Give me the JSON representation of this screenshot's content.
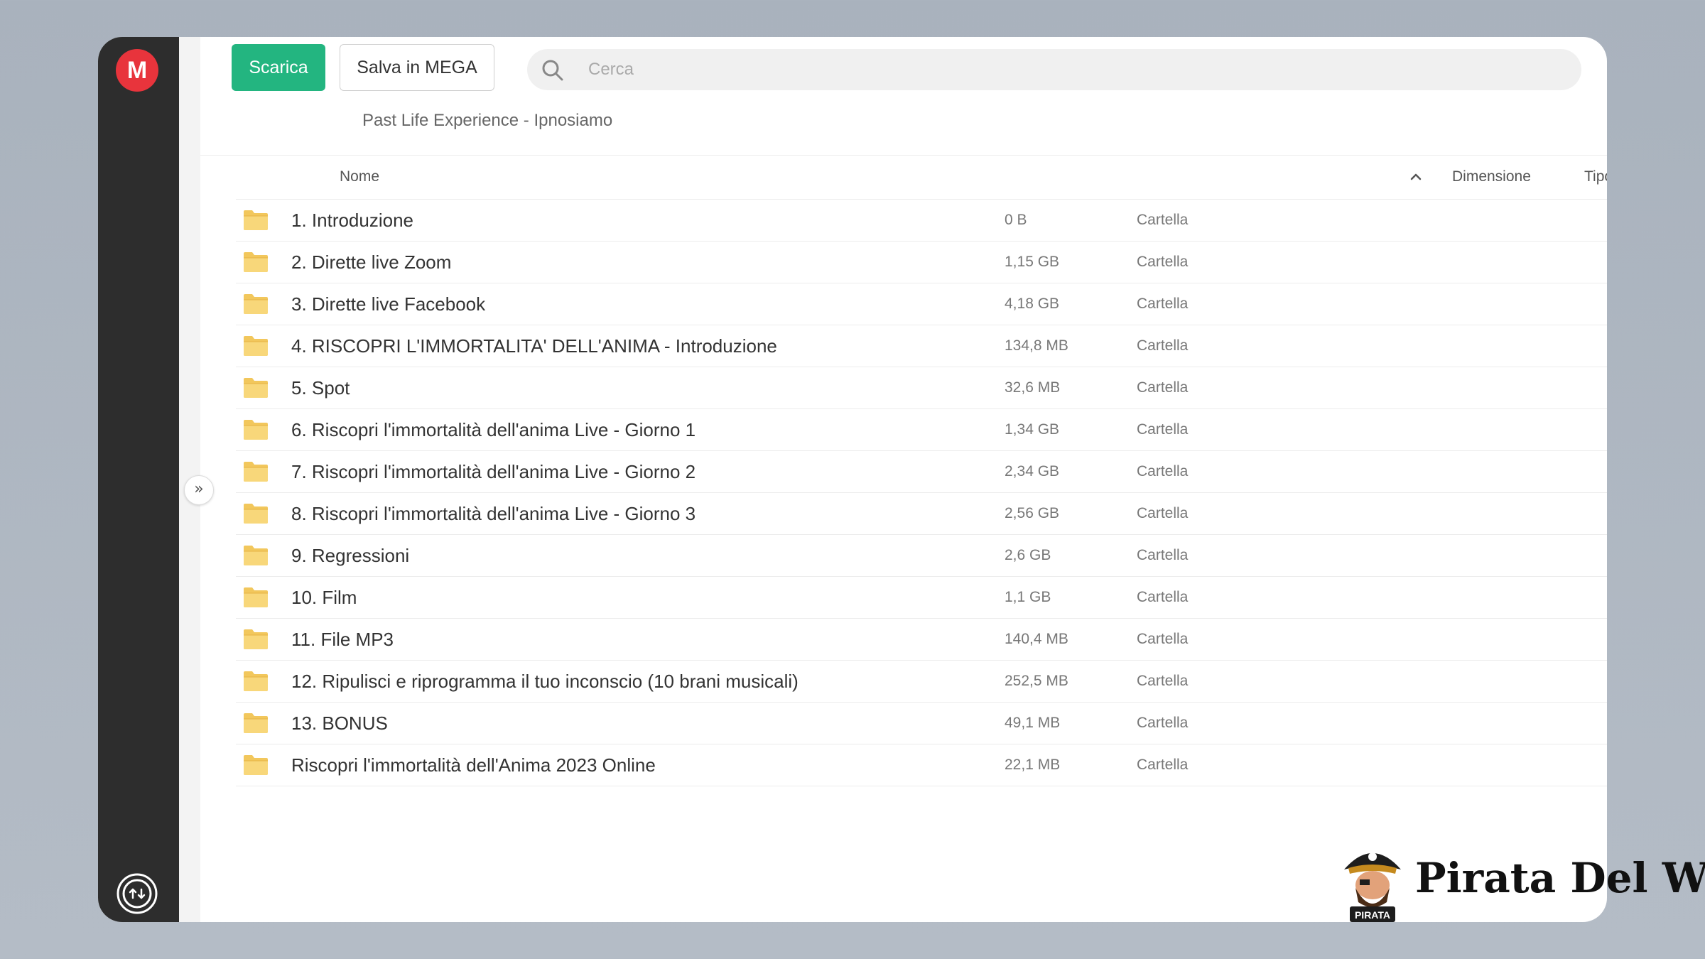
{
  "app": {
    "logo_letter": "M",
    "accent_color": "#e8343c"
  },
  "toolbar": {
    "download_label": "Scarica",
    "download_color": "#23b580",
    "save_label": "Salva in MEGA"
  },
  "search": {
    "placeholder": "Cerca",
    "value": ""
  },
  "breadcrumb": "Past Life Experience - Ipnosiamo",
  "table": {
    "headers": {
      "name": "Nome",
      "size": "Dimensione",
      "type": "Tipo"
    },
    "sort": "name-ascending",
    "rows": [
      {
        "name": "1. Introduzione",
        "size": "0 B",
        "type": "Cartella"
      },
      {
        "name": "2. Dirette live Zoom",
        "size": "1,15 GB",
        "type": "Cartella"
      },
      {
        "name": "3. Dirette live Facebook",
        "size": "4,18 GB",
        "type": "Cartella"
      },
      {
        "name": "4. RISCOPRI L'IMMORTALITA' DELL'ANIMA - Introduzione",
        "size": "134,8 MB",
        "type": "Cartella"
      },
      {
        "name": "5. Spot",
        "size": "32,6 MB",
        "type": "Cartella"
      },
      {
        "name": "6. Riscopri l'immortalità dell'anima Live - Giorno 1",
        "size": "1,34 GB",
        "type": "Cartella"
      },
      {
        "name": "7. Riscopri l'immortalità dell'anima Live - Giorno 2",
        "size": "2,34 GB",
        "type": "Cartella"
      },
      {
        "name": "8. Riscopri l'immortalità dell'anima Live - Giorno 3",
        "size": "2,56 GB",
        "type": "Cartella"
      },
      {
        "name": "9. Regressioni",
        "size": "2,6 GB",
        "type": "Cartella"
      },
      {
        "name": "10. Film",
        "size": "1,1 GB",
        "type": "Cartella"
      },
      {
        "name": "11. File MP3",
        "size": "140,4 MB",
        "type": "Cartella"
      },
      {
        "name": "12. Ripulisci e riprogramma il tuo inconscio (10 brani musicali)",
        "size": "252,5 MB",
        "type": "Cartella"
      },
      {
        "name": "13. BONUS",
        "size": "49,1 MB",
        "type": "Cartella"
      },
      {
        "name": "Riscopri l'immortalità dell'Anima 2023 Online",
        "size": "22,1 MB",
        "type": "Cartella"
      }
    ]
  },
  "icons": {
    "folder": "folder-icon",
    "search": "search-icon",
    "sort": "chevron-up-icon",
    "expand": "double-chevron-right-icon",
    "transfers": "transfer-icon"
  },
  "watermark": {
    "text": "Pirata Del Web",
    "badge": "PIRATA"
  }
}
